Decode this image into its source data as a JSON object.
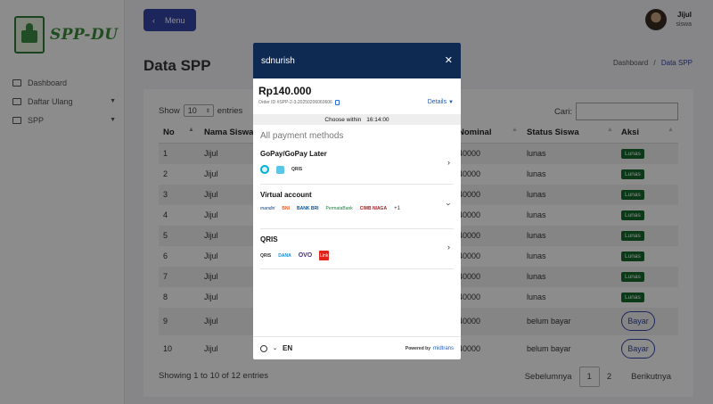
{
  "sidebar": {
    "logo_text": "SPP-DU",
    "items": [
      {
        "label": "Dashboard",
        "has_caret": false
      },
      {
        "label": "Daftar Ulang",
        "has_caret": true
      },
      {
        "label": "SPP",
        "has_caret": true
      }
    ]
  },
  "header": {
    "menu_label": "Menu",
    "menu_icon": "chevron-left-icon",
    "user_name": "Jijul",
    "user_role": "siswa"
  },
  "page": {
    "title": "Data SPP",
    "breadcrumb": [
      "Dashboard",
      "/",
      "Data SPP"
    ]
  },
  "table": {
    "show_label": "Show",
    "show_value": "10",
    "entries_label": "entries",
    "search_label": "Cari:",
    "columns": [
      "No",
      "Nama Siswa",
      "Nominal",
      "Status Siswa",
      "Aksi"
    ],
    "rows": [
      {
        "no": "1",
        "nama": "Jijul",
        "nominal": "40000",
        "status": "lunas",
        "aksi": "Lunas"
      },
      {
        "no": "2",
        "nama": "Jijul",
        "nominal": "40000",
        "status": "lunas",
        "aksi": "Lunas"
      },
      {
        "no": "3",
        "nama": "Jijul",
        "nominal": "40000",
        "status": "lunas",
        "aksi": "Lunas"
      },
      {
        "no": "4",
        "nama": "Jijul",
        "nominal": "40000",
        "status": "lunas",
        "aksi": "Lunas"
      },
      {
        "no": "5",
        "nama": "Jijul",
        "nominal": "40000",
        "status": "lunas",
        "aksi": "Lunas"
      },
      {
        "no": "6",
        "nama": "Jijul",
        "nominal": "40000",
        "status": "lunas",
        "aksi": "Lunas"
      },
      {
        "no": "7",
        "nama": "Jijul",
        "nominal": "40000",
        "status": "lunas",
        "aksi": "Lunas"
      },
      {
        "no": "8",
        "nama": "Jijul",
        "nominal": "40000",
        "status": "lunas",
        "aksi": "Lunas"
      },
      {
        "no": "9",
        "nama": "Jijul",
        "nominal": "40000",
        "status": "belum bayar",
        "aksi": "Bayar"
      },
      {
        "no": "10",
        "nama": "Jijul",
        "nominal": "40000",
        "status": "belum bayar",
        "aksi": "Bayar"
      }
    ],
    "footer_info": "Showing 1 to 10 of 12 entries",
    "pager": {
      "prev": "Sebelumnya",
      "pages": [
        "1",
        "2"
      ],
      "current": "1",
      "next": "Berikutnya"
    }
  },
  "modal": {
    "merchant": "sdnurish",
    "close_icon": "close-icon",
    "amount": "Rp140.000",
    "order_id": "Order ID #SPP-2-3-20250206060606",
    "details_label": "Details",
    "timer_label": "Choose within",
    "timer_value": "16:14:00",
    "all_methods_label": "All payment methods",
    "methods": [
      {
        "title": "GoPay/GoPay Later",
        "logos": [
          "gopay-logo",
          "gopay-later-logo",
          "qris-logo"
        ],
        "logo_texts": [
          "QRIS"
        ]
      },
      {
        "title": "Virtual account",
        "logos": [
          "mandiri-logo",
          "bni-logo",
          "bri-logo",
          "permata-logo",
          "cimb-logo"
        ],
        "logo_texts": [
          "mandiri",
          "BNI",
          "BANK BRI",
          "PermataBank",
          "CIMB NIAGA",
          "+1"
        ]
      },
      {
        "title": "QRIS",
        "logos": [
          "qris-logo",
          "dana-logo",
          "ovo-logo",
          "linkaja-logo"
        ],
        "logo_texts": [
          "QRIS",
          "DANA",
          "OVO",
          "Link"
        ]
      }
    ],
    "language": "EN",
    "powered_by": "Powered by",
    "brand": "midtrans"
  },
  "colors": {
    "accent": "#3346a8",
    "modal_header": "#0f2a52",
    "paid_badge": "#176b2f",
    "logo_green": "#3a8d3a"
  }
}
